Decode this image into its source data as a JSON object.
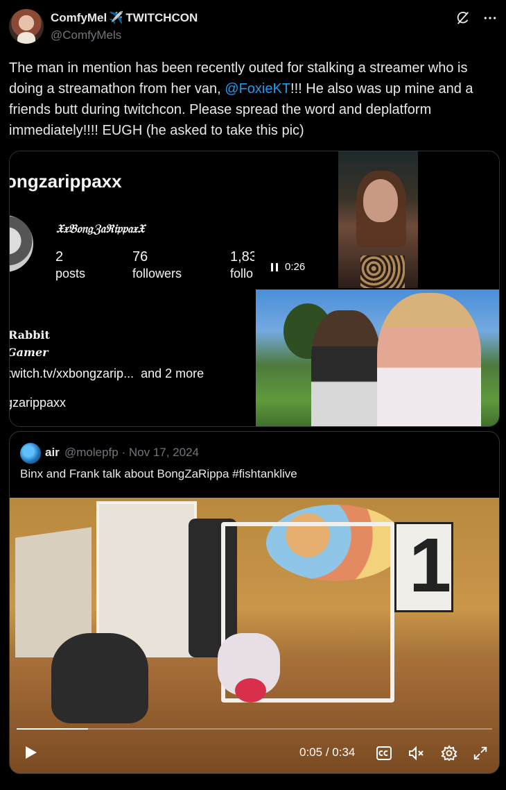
{
  "author": {
    "display_name": "ComfyMel",
    "display_name_suffix": "TWITCHCON",
    "plane_emoji": "✈️",
    "handle": "@ComfyMels"
  },
  "tweet": {
    "text_part1": "The man in mention has been recently outed for stalking a streamer who is doing a streamathon from her van, ",
    "mention": "@FoxieKT",
    "text_part2": "!!! He also was up mine and a friends butt during twitchcon. Please spread the word and deplatform immediately!!!! EUGH (he asked to take this pic)"
  },
  "media": {
    "instagram": {
      "username": "ongzarippaxx",
      "fancy_name": "𝔛𝔵𝔅𝔬𝔫𝔤ℨ𝔞ℜ𝔦𝔭𝔭𝔞𝔵𝔛",
      "posts_num": "2",
      "posts_label": "posts",
      "followers_num": "76",
      "followers_label": "followers",
      "following_num": "1,83",
      "following_label": "follo",
      "bio_line1": "Rabbit",
      "bio_line2": "Gamer",
      "link": "twitch.tv/xxbongzarip...",
      "link_more": "and 2 more",
      "handle2": "gzarippaxx"
    },
    "video": {
      "timer": "0:26"
    }
  },
  "quote": {
    "name": "air",
    "handle": "@molepfp",
    "date": "Nov 17, 2024",
    "text": "Binx and Frank talk about BongZaRippa #fishtanklive",
    "poster_number": "1",
    "video": {
      "current": "0:05",
      "duration": "0:34",
      "separator": "/",
      "progress_fraction": 0.15
    }
  },
  "colors": {
    "accent": "#1d9bf0",
    "background": "#000000",
    "text": "#e7e9ea",
    "muted": "#71767b",
    "border": "#2f3336"
  },
  "icons": {
    "grok": "grok-icon",
    "more": "more-icon",
    "play": "play-icon",
    "pause": "pause-icon",
    "captions": "captions-icon",
    "mute": "mute-icon",
    "settings": "settings-icon",
    "fullscreen": "fullscreen-icon"
  }
}
